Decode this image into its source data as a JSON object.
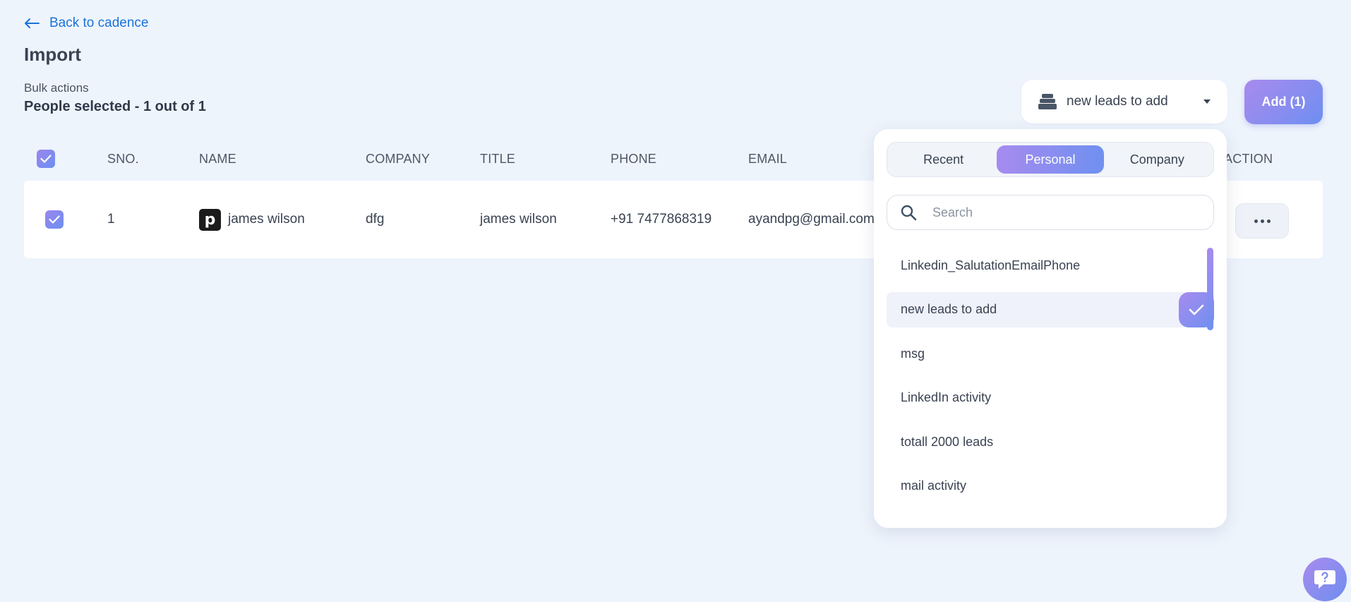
{
  "nav": {
    "back_label": "Back to cadence"
  },
  "page": {
    "title": "Import",
    "bulk_actions_label": "Bulk actions",
    "selected_text": "People selected - 1 out of 1"
  },
  "toolbar": {
    "list_selected": "new leads to add",
    "add_button": "Add (1)"
  },
  "table": {
    "columns": [
      "SNO.",
      "NAME",
      "COMPANY",
      "TITLE",
      "PHONE",
      "EMAIL",
      "ACTION"
    ],
    "rows": [
      {
        "sno": "1",
        "avatar_letter": "p",
        "name": "james wilson",
        "company": "dfg",
        "title": "james wilson",
        "phone": "+91 7477868319",
        "email": "ayandpg@gmail.com"
      }
    ]
  },
  "dropdown": {
    "tabs": [
      "Recent",
      "Personal",
      "Company"
    ],
    "active_tab": "Personal",
    "search_placeholder": "Search",
    "items": [
      "Linkedin_SalutationEmailPhone",
      "new leads to add",
      "msg",
      "LinkedIn activity",
      "totall 2000 leads",
      "mail activity"
    ],
    "selected_item": "new leads to add"
  },
  "colors": {
    "accent_gradient_start": "#a98aee",
    "accent_gradient_end": "#6e8ff0",
    "link": "#1a73d9",
    "background": "#eef4fc"
  }
}
